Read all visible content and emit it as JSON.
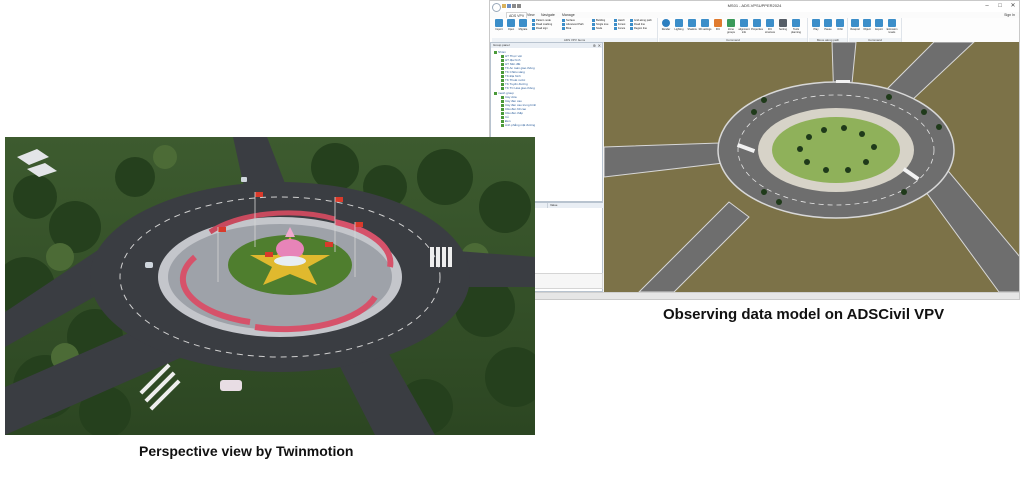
{
  "app": {
    "title": "MS01 - ADS.VPSUPPER2024",
    "window_controls": {
      "minimize": "–",
      "maximize": "□",
      "close": "✕"
    },
    "menu": [
      "ADS VPV",
      "View",
      "Navigate",
      "Manage"
    ],
    "active_menu": "ADS VPV",
    "sign_in": "Sign In",
    "ribbon": {
      "group1": {
        "label": "ADS VPV Items",
        "big_buttons": [
          "Import",
          "Open",
          "Migrate"
        ],
        "small_col1": [
          "Pattern node",
          "Road marking",
          "Road sign"
        ],
        "small_col2": [
          "Surface",
          "Advanced Path",
          "Bina"
        ],
        "small_col3": [
          "Building",
          "Single tree",
          "Node"
        ],
        "small_col4": [
          "Hatch",
          "Forest",
          "Fence"
        ],
        "small_col5": [
          "Grid along path",
          "Road line",
          "Region line"
        ]
      },
      "group2": {
        "label": "Command",
        "big_buttons": [
          "Render",
          "Lighting",
          "Shadow",
          "3D settings",
          "IFC",
          "Zone groups",
          "alignment info",
          "Properties",
          "IFC structure",
          "Setting",
          "Tools planning"
        ]
      },
      "group3": {
        "label": "Move along path",
        "big_buttons": [
          "Play",
          "Pause",
          "Orbit"
        ]
      },
      "group4": {
        "label": "Command",
        "big_buttons": [
          "Viewport",
          "Object",
          "Export",
          "Extrusion levels"
        ]
      }
    },
    "group_panel": {
      "title": "Group panel",
      "items": [
        "Nhóm",
        "HT Thực vật",
        "HT địa hình",
        "HT Nền đất",
        "TK An toàn giao thông",
        "TK Chiếu sáng",
        "TK Địa hình",
        "TK Thoát nước",
        "TK Tuyến đường",
        "TK TC Hoá giao thông",
        "mesh group",
        "Cây dừa",
        "Cây đèn cao",
        "Cây đèn cao trung bình",
        "Cầu đèn 60 cao",
        "Cầu đèn thấp",
        "Cỏ",
        "Đèn",
        "Ảnh phẳng mặt đường"
      ]
    },
    "props_panel": {
      "col1": "",
      "col2": "Value"
    },
    "accent": "#1e6fb8"
  },
  "captions": {
    "right": "Observing data model on ADSCivil VPV",
    "left": "Perspective view by Twinmotion"
  }
}
